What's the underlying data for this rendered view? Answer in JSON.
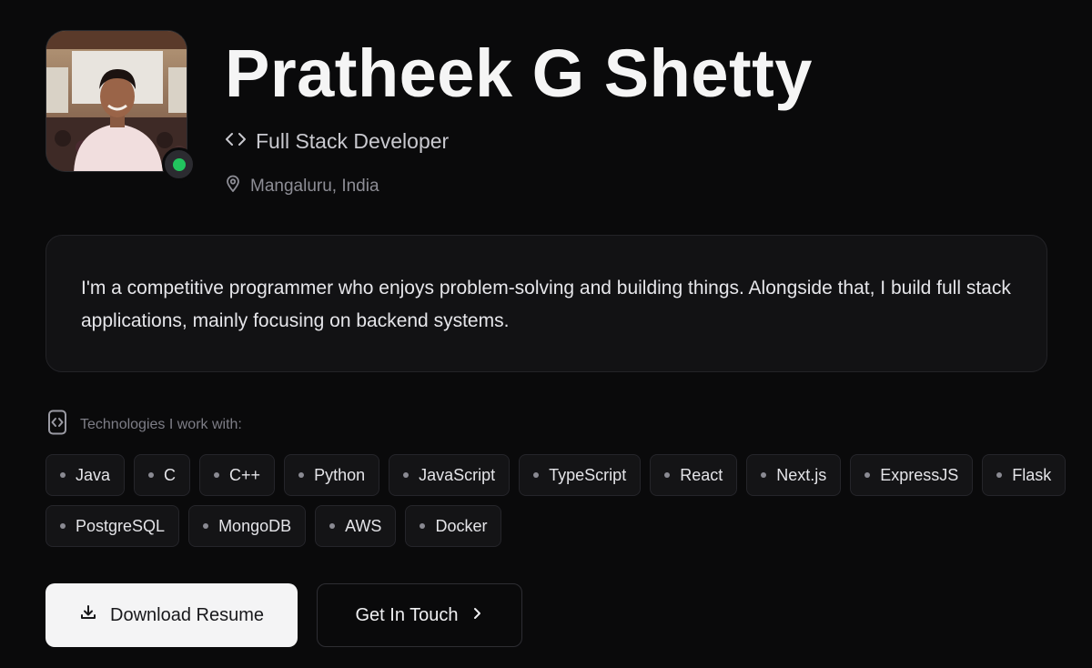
{
  "profile": {
    "name": "Pratheek G Shetty",
    "role": "Full Stack Developer",
    "location": "Mangaluru, India",
    "status": "online",
    "status_color": "#22c55e"
  },
  "bio": {
    "text": "I'm a competitive programmer who enjoys problem-solving and building things. Alongside that, I build full stack applications, mainly focusing on backend systems."
  },
  "tech": {
    "heading": "Technologies I work with:",
    "row1": [
      "Java",
      "C",
      "C++",
      "Python",
      "JavaScript",
      "TypeScript",
      "React",
      "Next.js",
      "ExpressJS",
      "Flask"
    ],
    "row2": [
      "PostgreSQL",
      "MongoDB",
      "AWS",
      "Docker"
    ]
  },
  "actions": {
    "download_label": "Download Resume",
    "contact_label": "Get In Touch"
  },
  "icons": {
    "role": "code-brackets-icon",
    "location": "map-pin-icon",
    "tech": "code-file-icon",
    "download": "download-icon",
    "contact": "chevron-right-icon"
  },
  "colors": {
    "background": "#0a0a0b",
    "card": "#121214",
    "primary_button": "#f4f4f5"
  }
}
